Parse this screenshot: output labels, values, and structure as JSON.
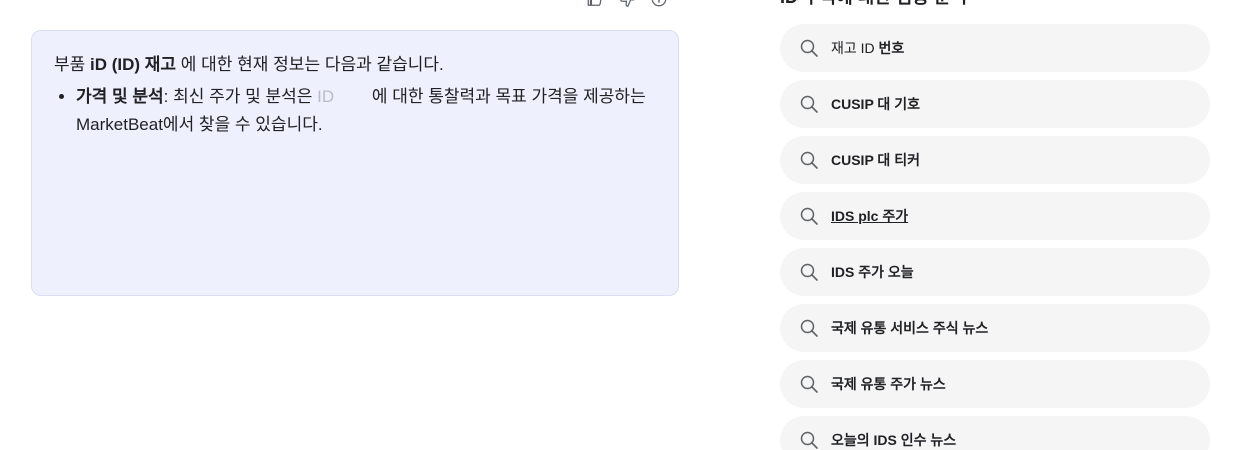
{
  "feedback": {
    "icons": [
      "thumbs-up-icon",
      "thumbs-down-icon",
      "info-icon"
    ]
  },
  "answer": {
    "intro_prefix": "부품 ",
    "intro_bold": "iD (ID) 재고",
    "intro_suffix": " 에 대한 현재 정보는 다음과 같습니다.",
    "bullet_bold": "가격 및 분석",
    "bullet_text_1": ": 최신 주가 및 분석은 ",
    "bullet_link": "ID",
    "bullet_text_2": " 에 대한 통찰력과 목표 가격을 제공하는 MarketBeat에서 찾을 수 있습니다."
  },
  "related": {
    "heading": "ID 주식에 대한 심층 분석",
    "items": [
      {
        "plain": "재고 ID ",
        "bold": "번호",
        "icon": "search-icon"
      },
      {
        "plain": "",
        "bold": "CUSIP 대 기호",
        "icon": "search-icon"
      },
      {
        "plain": "",
        "bold": "CUSIP 대 티커",
        "icon": "search-icon"
      },
      {
        "plain": "",
        "bold": "IDS plc 주가",
        "icon": "search-icon"
      },
      {
        "plain": "",
        "bold": "IDS 주가 오늘",
        "icon": "search-icon"
      },
      {
        "plain": "",
        "bold": "국제 유통 서비스 주식 뉴스",
        "icon": "search-icon"
      },
      {
        "plain": "",
        "bold": "국제 유통 주가 뉴스",
        "icon": "search-icon"
      },
      {
        "plain": "",
        "bold": "오늘의 IDS 인수 뉴스",
        "icon": "search-icon"
      }
    ]
  }
}
